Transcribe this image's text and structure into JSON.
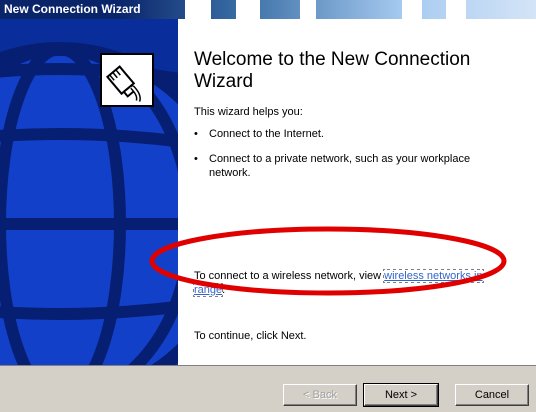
{
  "window": {
    "title": "New Connection Wizard"
  },
  "welcome": {
    "heading": "Welcome to the New Connection Wizard",
    "intro": "This wizard helps you:",
    "bullets": [
      "Connect to the Internet.",
      "Connect to a private network, such as your workplace network."
    ],
    "wireless_prefix": "To connect to a wireless network, view ",
    "wireless_link": "wireless networks in range",
    "wireless_suffix": ".",
    "continue_text": "To continue, click Next."
  },
  "buttons": {
    "back": "< Back",
    "next": "Next >",
    "cancel": "Cancel"
  },
  "icons": {
    "wizard": "network-cable-icon",
    "art": "globe-icon"
  },
  "colors": {
    "titlebar": "#0a246a",
    "art_panel": "#0a2d9c",
    "annotation": "#e00000",
    "link": "#3366cc"
  }
}
